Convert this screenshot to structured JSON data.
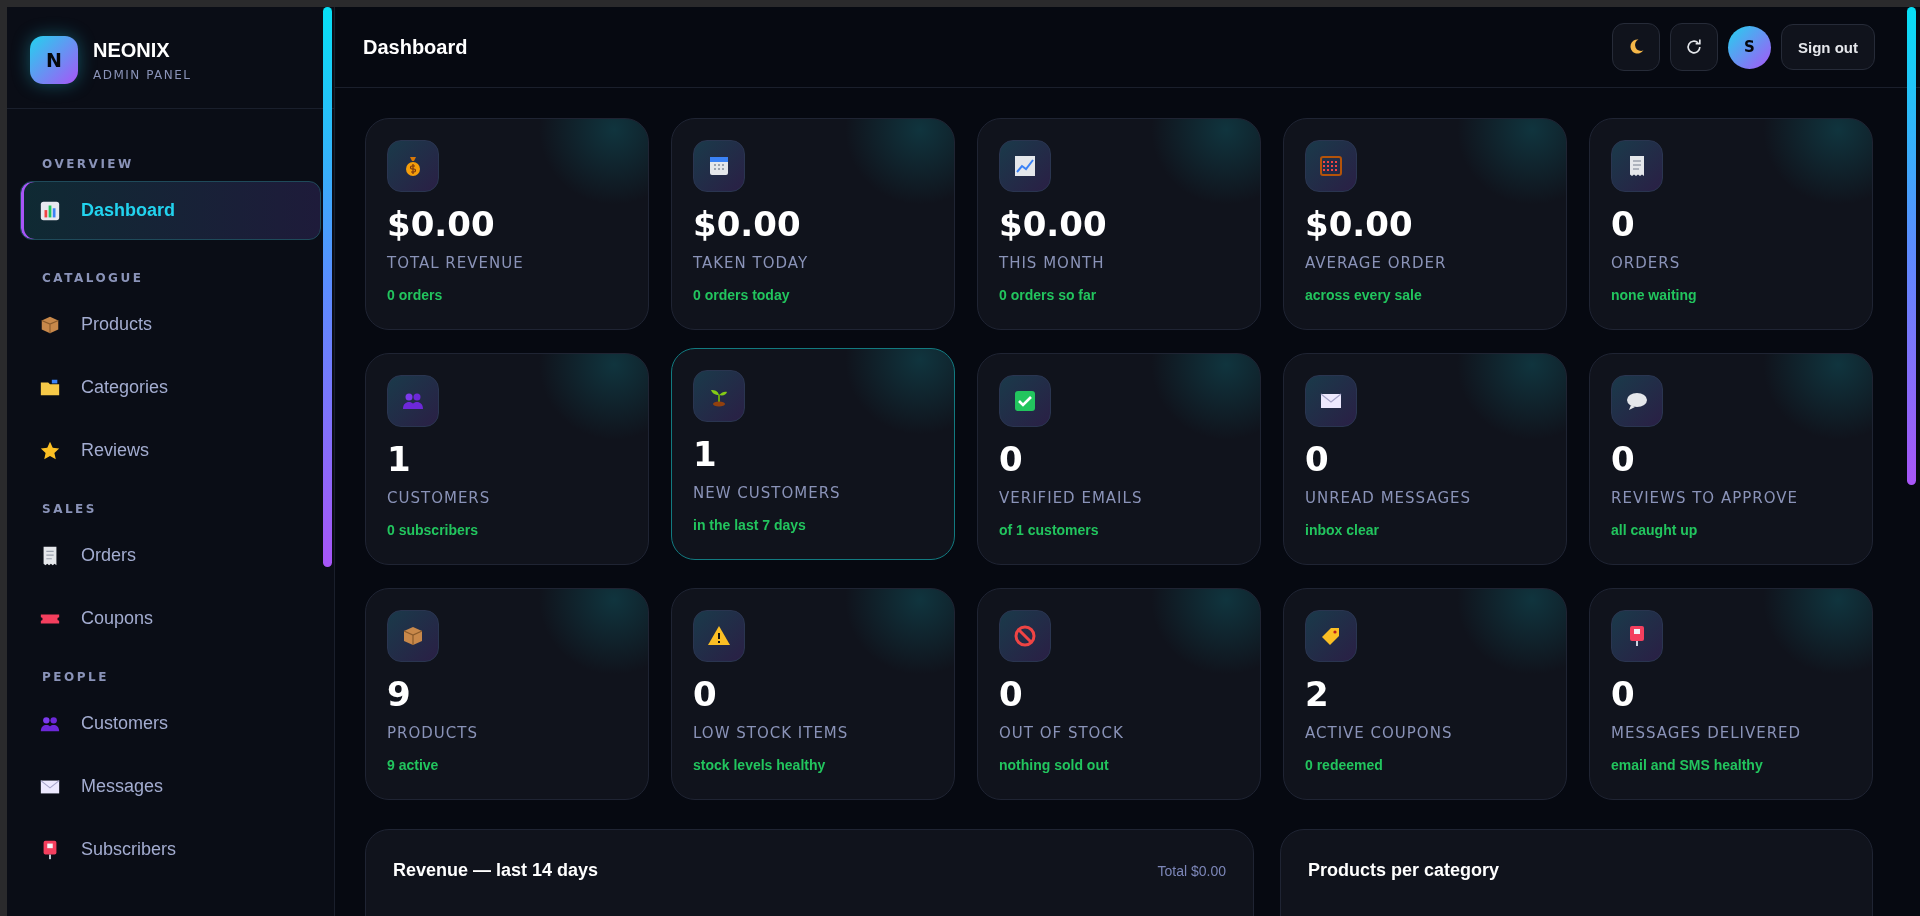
{
  "brand": {
    "logo_letter": "N",
    "name": "NEONIX",
    "subtitle": "ADMIN PANEL"
  },
  "sidebar": {
    "sections": [
      {
        "label": "OVERVIEW",
        "items": [
          {
            "label": "Dashboard",
            "selected": true
          }
        ]
      },
      {
        "label": "CATALOGUE",
        "items": [
          {
            "label": "Products",
            "selected": false
          },
          {
            "label": "Categories",
            "selected": false
          },
          {
            "label": "Reviews",
            "selected": false
          }
        ]
      },
      {
        "label": "SALES",
        "items": [
          {
            "label": "Orders",
            "selected": false
          },
          {
            "label": "Coupons",
            "selected": false
          }
        ]
      },
      {
        "label": "PEOPLE",
        "items": [
          {
            "label": "Customers",
            "selected": false
          },
          {
            "label": "Messages",
            "selected": false
          },
          {
            "label": "Subscribers",
            "selected": false
          }
        ]
      }
    ]
  },
  "header": {
    "title": "Dashboard",
    "avatar_letter": "S",
    "sign_out": "Sign out"
  },
  "stats": [
    {
      "value": "$0.00",
      "label": "TOTAL REVENUE",
      "note": "0 orders",
      "highlighted": false
    },
    {
      "value": "$0.00",
      "label": "TAKEN TODAY",
      "note": "0 orders today",
      "highlighted": false
    },
    {
      "value": "$0.00",
      "label": "THIS MONTH",
      "note": "0 orders so far",
      "highlighted": false
    },
    {
      "value": "$0.00",
      "label": "AVERAGE ORDER",
      "note": "across every sale",
      "highlighted": false
    },
    {
      "value": "0",
      "label": "ORDERS",
      "note": "none waiting",
      "highlighted": false
    },
    {
      "value": "1",
      "label": "CUSTOMERS",
      "note": "0 subscribers",
      "highlighted": false
    },
    {
      "value": "1",
      "label": "NEW CUSTOMERS",
      "note": "in the last 7 days",
      "highlighted": true
    },
    {
      "value": "0",
      "label": "VERIFIED EMAILS",
      "note": "of 1 customers",
      "highlighted": false
    },
    {
      "value": "0",
      "label": "UNREAD MESSAGES",
      "note": "inbox clear",
      "highlighted": false
    },
    {
      "value": "0",
      "label": "REVIEWS TO APPROVE",
      "note": "all caught up",
      "highlighted": false
    },
    {
      "value": "9",
      "label": "PRODUCTS",
      "note": "9 active",
      "highlighted": false
    },
    {
      "value": "0",
      "label": "LOW STOCK ITEMS",
      "note": "stock levels healthy",
      "highlighted": false
    },
    {
      "value": "0",
      "label": "OUT OF STOCK",
      "note": "nothing sold out",
      "highlighted": false
    },
    {
      "value": "2",
      "label": "ACTIVE COUPONS",
      "note": "0 redeemed",
      "highlighted": false
    },
    {
      "value": "0",
      "label": "MESSAGES DELIVERED",
      "note": "email and SMS healthy",
      "highlighted": false
    }
  ],
  "revenue_panel": {
    "title": "Revenue — last 14 days",
    "total": "Total $0.00"
  },
  "category_panel": {
    "title": "Products per category"
  }
}
